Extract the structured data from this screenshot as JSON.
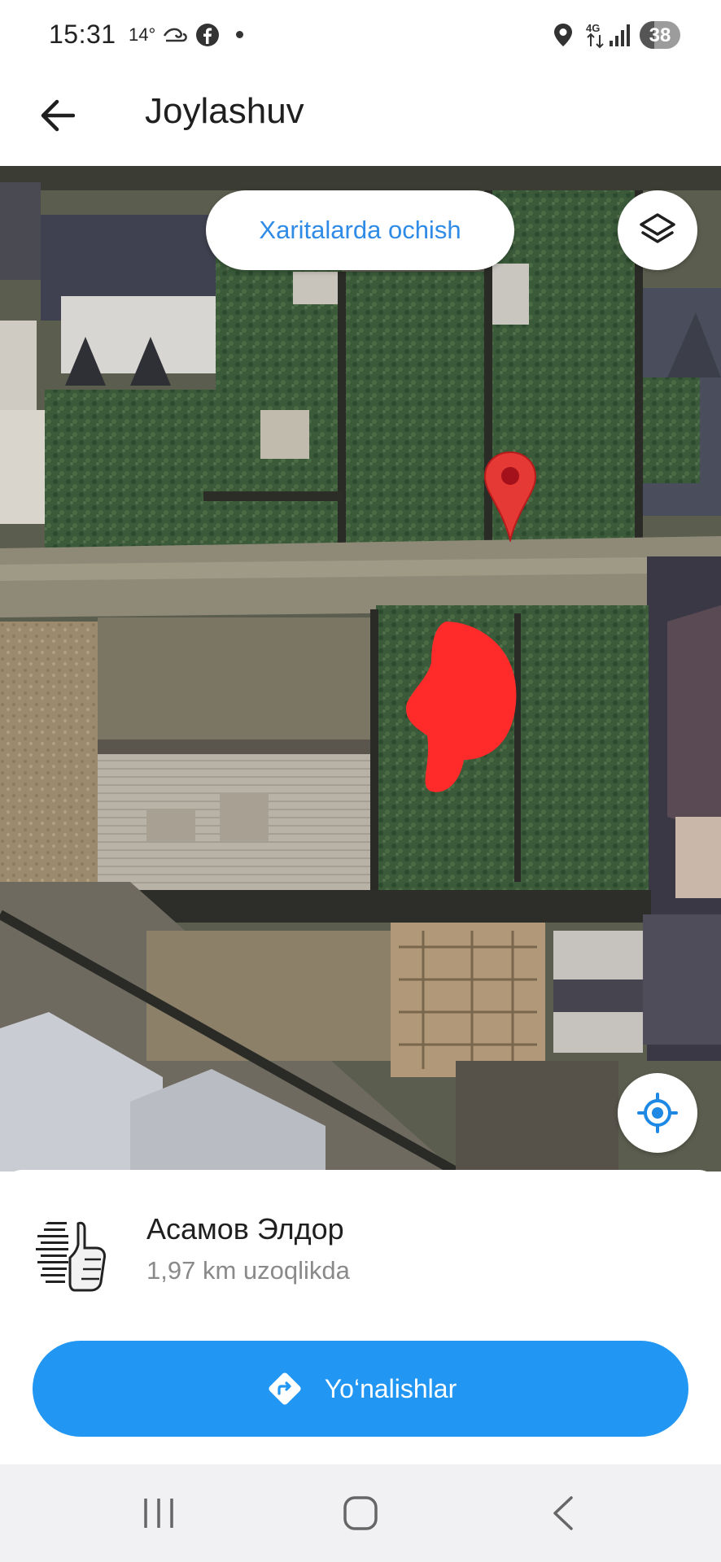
{
  "status_bar": {
    "time": "15:31",
    "temperature": "14°",
    "network": "4G",
    "battery": "38",
    "icons": [
      "wind-icon",
      "facebook-icon",
      "notification-dot",
      "location-icon",
      "signal-icon",
      "battery-icon"
    ]
  },
  "header": {
    "title": "Joylashuv",
    "back_icon": "arrow-left-icon"
  },
  "map": {
    "open_in_maps_label": "Xaritalarda ochish",
    "layers_icon": "layers-icon",
    "locate_icon": "my-location-icon",
    "pin_color": "#e53935",
    "marker_color": "#ff2a2a"
  },
  "seller": {
    "name": "Асамов Элдор",
    "distance": "1,97 km uzoqlikda",
    "avatar_icon": "avatar-thumbs-up-icon"
  },
  "actions": {
    "directions_label": "Yo‘nalishlar",
    "directions_icon": "directions-icon",
    "accent_color": "#2196f3"
  },
  "nav_bar": {
    "icons": [
      "recents-icon",
      "home-icon",
      "back-icon"
    ]
  }
}
